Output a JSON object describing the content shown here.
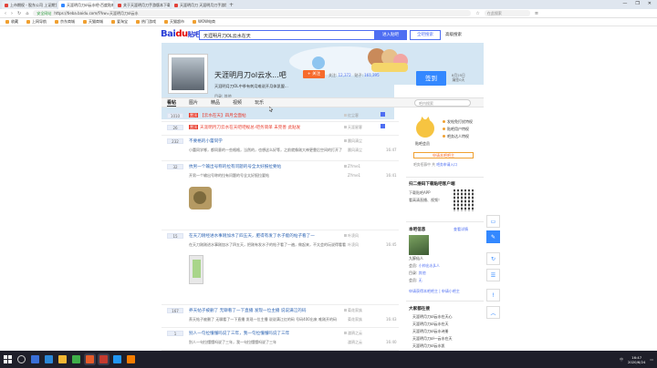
{
  "browser": {
    "tabs": [
      {
        "label": "上市期权 - 股东公司 上证期货",
        "active": false
      },
      {
        "label": "天涯明月刀ol云水吧-百度贴吧",
        "active": true
      },
      {
        "label": "关于天涯明月刀手游版本下载安装",
        "active": false
      },
      {
        "label": "天涯明月刀 天涯明月刀手游版本",
        "active": false
      }
    ],
    "new_tab": "+",
    "controls": [
      "—",
      "❐",
      "✕"
    ],
    "url_secure": "安全网站",
    "url": "https://tieba.baidu.com/f?kw=天涯明月刀ol云水",
    "right_search": "在此搜索"
  },
  "bookmarks": [
    "收藏",
    "上网导航",
    "京东商城",
    "天猫商城",
    "爱淘宝",
    "热门游戏",
    "天猫超市",
    "WOW电商"
  ],
  "header": {
    "logo_text": "Bai",
    "logo_mark": "du",
    "logo_suffix": "贴吧",
    "search_value": "天涯明月刀OL云水在天",
    "enter_button": "进入贴吧",
    "global_button": "全吧搜索",
    "advanced": "高级搜索"
  },
  "banner": {
    "bar_name": "天涯明月刀ol云水...吧",
    "follow": "+ 关注",
    "stats_members_label": "关注:",
    "stats_members": "12,372",
    "stats_posts_label": "贴子:",
    "stats_posts": "161,395",
    "slogan": "天涯明月刀OL中季有刺月难说开月体凯盟...",
    "meta_label": "目录:",
    "meta_value": "其他",
    "sign_button": "签到",
    "sign_info_1": "8月25日",
    "sign_info_2": "漏签0天"
  },
  "nav": {
    "tabs": [
      "看帖",
      "图片",
      "精品",
      "视频",
      "玩乐"
    ],
    "search_placeholder": "吧内搜索"
  },
  "threads": [
    {
      "replies": "1010",
      "tag": "置顶",
      "tag_color": "#e83a2b",
      "title": "【云水在天】四月全面帖",
      "title_red": true,
      "author": "红尘客",
      "excerpt": "",
      "last": "",
      "time": "",
      "pinned": true
    },
    {
      "replies": "26",
      "tag": "置顶",
      "tag_color": "#e83a2b",
      "title": "天涯明月刀云水在天吧吧规总-吧务简单 未完善 此贴发",
      "title_red": true,
      "author": "天涯星客",
      "excerpt": "",
      "last": "",
      "time": "",
      "pinned": true
    },
    {
      "replies": "232",
      "tag": "",
      "tag_color": "",
      "title": "不要格的小蕾同学",
      "title_red": false,
      "author": "晨风清尘",
      "excerpt": "小蕾同学哪，都同意的一些格格，当然的，也想这么好等，之前就像刚大神更靠后空间的打开了",
      "last": "晨风清尘",
      "time": "16:47",
      "pinned": false
    },
    {
      "replies": "32",
      "tag": "",
      "tag_color": "",
      "title": "抗男一个输出号称的拉有问题的号全太好报拉要帖",
      "title_red": false,
      "author": "ZYme1",
      "excerpt": "开男一个输出号称的拉有问题的号全太好报拉要帖",
      "last": "ZYme1",
      "time": "16:41",
      "pinned": false
    },
    {
      "replies": "15",
      "tag": "",
      "tag_color": "",
      "title": "在天刀刚经进水事刚加水了四五天，肥得有发了水子能的帖子看了一",
      "title_red": false,
      "author": "叶凌风",
      "excerpt": "在天刀刚刚进水事刚加水了四五天，把刚有发水子的帖子看了一遍，做起来，不太会的玩说得看看",
      "last": "叶凌风",
      "time": "16:45",
      "pinned": false
    },
    {
      "replies": "167",
      "tag": "",
      "tag_color": "",
      "title": "养天帖子被删了 无聊看了一下直播 发现一位主播 说说满江的码",
      "title_red": false,
      "author": "菊花家族",
      "excerpt": "养天帖子被删了 无聊看了一下直播 发现一位主播 说说满江红的码 号码400出来 唯刚开的码",
      "last": "菊花家族",
      "time": "16:43",
      "pinned": false
    },
    {
      "replies": "1",
      "tag": "",
      "tag_color": "",
      "title": "别人一句拉懂懂吗说了三年，我一句拉懂懂吗说了三年",
      "title_red": false,
      "author": "渡鸦之云",
      "excerpt": "别人一句拉懂懂吗说了三年，我一句拉懂懂吗说了三年",
      "last": "渡鸦之云",
      "time": "16:40",
      "pinned": false
    }
  ],
  "aside": {
    "crown_label": "贴吧会员",
    "benefits": [
      "发帖免打扰特权",
      "贴吧用户特权",
      "吧务达人特权"
    ],
    "manager_button": "申请本吧吧主",
    "manager_text_1": "吧务招募中 共",
    "manager_text_link": "吧务申请入口",
    "qr_title": "扫二维码下载贴吧客户端",
    "qr_lines": [
      "下载贴吧APP",
      "看高清直播、视频！"
    ],
    "info_title": "本吧信息",
    "info_more": "查看详情",
    "owner": "九醉仙人",
    "info_lines": [
      {
        "label": "会员:",
        "value": "小帅出水JL人"
      },
      {
        "label": "目录:",
        "value": "其他"
      },
      {
        "label": "会员:",
        "value": "无"
      }
    ],
    "contact": "申请获得本吧吧主 | 申请小吧主",
    "rec_title": "大家都在搜",
    "recs": [
      "天涯明月刀ol云水在天心",
      "天涯明月刀ol云水在天",
      "天涯明月刀ol云水诗册",
      "天涯明月刀ol一云水在天",
      "天涯明月刀ol云水凯"
    ]
  },
  "float_tools": [
    "▭",
    "✎",
    "↻",
    "☰",
    "!",
    "︿"
  ],
  "taskbar": {
    "tray_text": "中",
    "time": "16:47",
    "date": "2020/6/24"
  }
}
